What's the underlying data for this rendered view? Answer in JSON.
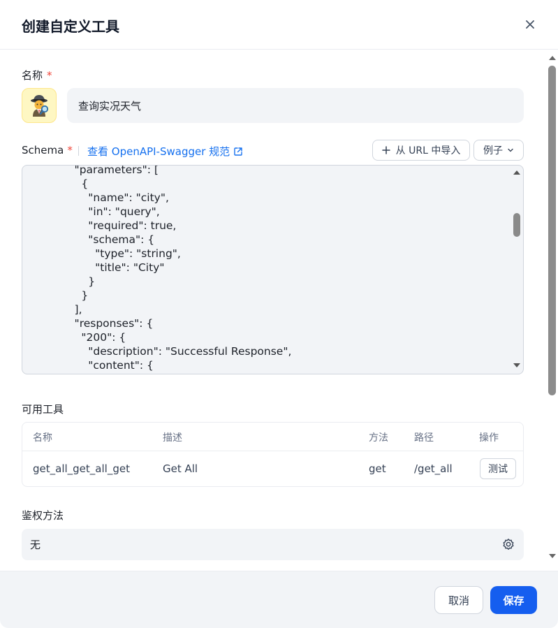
{
  "dialog": {
    "title": "创建自定义工具",
    "close_icon": "close-icon"
  },
  "name_field": {
    "label": "名称",
    "required_mark": "*",
    "avatar_icon": "detective-emoji-icon",
    "value": "查询实况天气"
  },
  "schema": {
    "label": "Schema",
    "required_mark": "*",
    "spec_link": "查看 OpenAPI-Swagger 规范",
    "import_button": "从 URL 中导入",
    "example_button": "例子",
    "code": "      \"parameters\": [\n        {\n          \"name\": \"city\",\n          \"in\": \"query\",\n          \"required\": true,\n          \"schema\": {\n            \"type\": \"string\",\n            \"title\": \"City\"\n          }\n        }\n      ],\n      \"responses\": {\n        \"200\": {\n          \"description\": \"Successful Response\",\n          \"content\": {"
  },
  "tools": {
    "label": "可用工具",
    "columns": [
      "名称",
      "描述",
      "方法",
      "路径",
      "操作"
    ],
    "rows": [
      {
        "name": "get_all_get_all_get",
        "description": "Get All",
        "method": "get",
        "path": "/get_all",
        "action": "测试"
      }
    ]
  },
  "auth": {
    "label": "鉴权方法",
    "value": "无",
    "settings_icon": "gear-icon"
  },
  "footer": {
    "cancel": "取消",
    "save": "保存"
  },
  "colors": {
    "primary": "#155eef",
    "link": "#1570ef",
    "required": "#f04438",
    "field_bg": "#f2f4f7"
  }
}
